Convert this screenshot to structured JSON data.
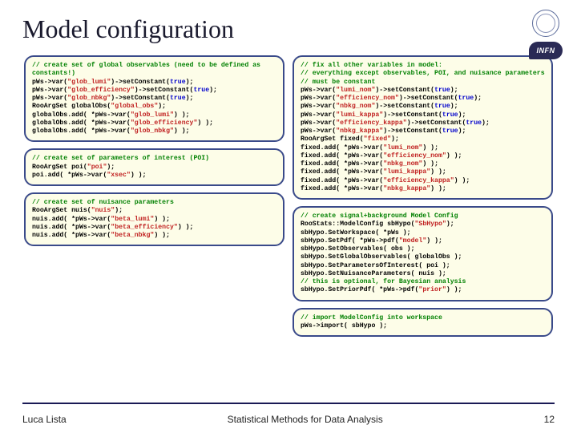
{
  "title": "Model configuration",
  "logo_infn_text": "INFN",
  "footer": {
    "left": "Luca Lista",
    "center": "Statistical Methods for Data Analysis",
    "page": "12"
  },
  "left": {
    "box1": {
      "c1": "// create set of global observables (need to be defined as constants!)",
      "l1a": "pWs->var(",
      "l1s": "\"glob_lumi\"",
      "l1b": ")->setConstant(",
      "l1k": "true",
      "l1c": ");",
      "l2a": "pWs->var(",
      "l2s": "\"glob_efficiency\"",
      "l2b": ")->setConstant(",
      "l2k": "true",
      "l2c": ");",
      "l3a": "pWs->var(",
      "l3s": "\"glob_nbkg\"",
      "l3b": ")->setConstant(",
      "l3k": "true",
      "l3c": ");",
      "l4a": "RooArgSet globalObs(",
      "l4s": "\"global_obs\"",
      "l4b": ");",
      "l5a": "globalObs.add( *pWs->var(",
      "l5s": "\"glob_lumi\"",
      "l5b": ") );",
      "l6a": "globalObs.add( *pWs->var(",
      "l6s": "\"glob_efficiency\"",
      "l6b": ") );",
      "l7a": "globalObs.add( *pWs->var(",
      "l7s": "\"glob_nbkg\"",
      "l7b": ") );"
    },
    "box2": {
      "c1": "// create set of parameters of interest (POI)",
      "l1a": "RooArgSet poi(",
      "l1s": "\"poi\"",
      "l1b": ");",
      "l2a": "poi.add( *pWs->var(",
      "l2s": "\"xsec\"",
      "l2b": ") );"
    },
    "box3": {
      "c1": "// create set of nuisance parameters",
      "l1a": "RooArgSet nuis(",
      "l1s": "\"nuis\"",
      "l1b": ");",
      "l2a": "nuis.add( *pWs->var(",
      "l2s": "\"beta_lumi\"",
      "l2b": ") );",
      "l3a": "nuis.add( *pWs->var(",
      "l3s": "\"beta_efficiency\"",
      "l3b": ") );",
      "l4a": "nuis.add( *pWs->var(",
      "l4s": "\"beta_nbkg\"",
      "l4b": ") );"
    }
  },
  "right": {
    "box1": {
      "c1": "// fix all other variables in model:",
      "c2": "// everything except observables, POI, and nuisance parameters",
      "c3": "// must be constant",
      "l1a": "pWs->var(",
      "l1s": "\"lumi_nom\"",
      "l1b": ")->setConstant(",
      "l1k": "true",
      "l1c": ");",
      "l2a": "pWs->var(",
      "l2s": "\"efficiency_nom\"",
      "l2b": ")->setConstant(",
      "l2k": "true",
      "l2c": ");",
      "l3a": "pWs->var(",
      "l3s": "\"nbkg_nom\"",
      "l3b": ")->setConstant(",
      "l3k": "true",
      "l3c": ");",
      "l4a": "pWs->var(",
      "l4s": "\"lumi_kappa\"",
      "l4b": ")->setConstant(",
      "l4k": "true",
      "l4c": ");",
      "l5a": "pWs->var(",
      "l5s": "\"efficiency_kappa\"",
      "l5b": ")->setConstant(",
      "l5k": "true",
      "l5c": ");",
      "l6a": "pWs->var(",
      "l6s": "\"nbkg_kappa\"",
      "l6b": ")->setConstant(",
      "l6k": "true",
      "l6c": ");",
      "l7a": "RooArgSet fixed(",
      "l7s": "\"fixed\"",
      "l7b": ");",
      "l8a": "fixed.add( *pWs->var(",
      "l8s": "\"lumi_nom\"",
      "l8b": ") );",
      "l9a": "fixed.add( *pWs->var(",
      "l9s": "\"efficiency_nom\"",
      "l9b": ") );",
      "l10a": "fixed.add( *pWs->var(",
      "l10s": "\"nbkg_nom\"",
      "l10b": ") );",
      "l11a": "fixed.add( *pWs->var(",
      "l11s": "\"lumi_kappa\"",
      "l11b": ") );",
      "l12a": "fixed.add( *pWs->var(",
      "l12s": "\"efficiency_kappa\"",
      "l12b": ") );",
      "l13a": "fixed.add( *pWs->var(",
      "l13s": "\"nbkg_kappa\"",
      "l13b": ") );"
    },
    "box2": {
      "c1": "// create signal+background Model Config",
      "l1a": "RooStats::ModelConfig sbHypo(",
      "l1s": "\"SbHypo\"",
      "l1b": ");",
      "l2": "sbHypo.SetWorkspace( *pWs );",
      "l3a": "sbHypo.SetPdf( *pWs->pdf(",
      "l3s": "\"model\"",
      "l3b": ") );",
      "l4": "sbHypo.SetObservables( obs );",
      "l5": "sbHypo.SetGlobalObservables( globalObs );",
      "l6": "sbHypo.SetParametersOfInterest( poi );",
      "l7": "sbHypo.SetNuisanceParameters( nuis );",
      "c2": "// this is optional, for Bayesian analysis",
      "l8a": "sbHypo.SetPriorPdf( *pWs->pdf(",
      "l8s": "\"prior\"",
      "l8b": ") );"
    },
    "box3": {
      "c1": "// import ModelConfig into workspace",
      "l1": "pWs->import( sbHypo );"
    }
  }
}
